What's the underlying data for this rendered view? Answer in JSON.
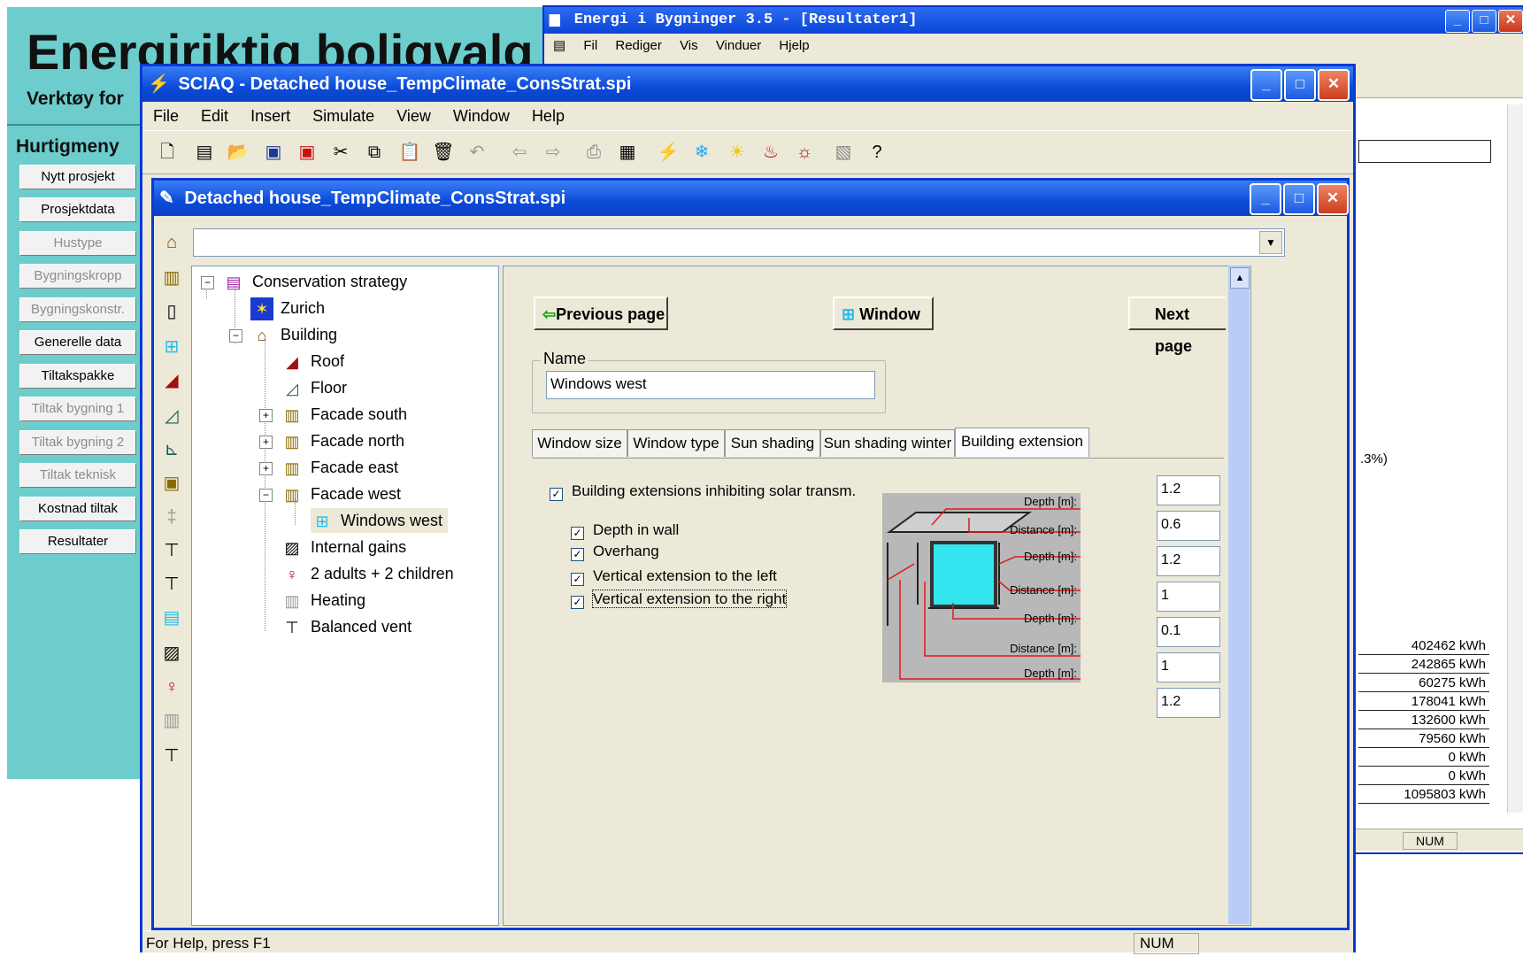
{
  "background_app": {
    "title": "Energiriktig boligvalg",
    "subtitle": "Verktøy for",
    "quickmenu_title": "Hurtigmeny",
    "buttons": [
      {
        "label": "Nytt prosjekt",
        "enabled": true
      },
      {
        "label": "Prosjektdata",
        "enabled": true
      },
      {
        "label": "Hustype",
        "enabled": false
      },
      {
        "label": "Bygningskropp",
        "enabled": false
      },
      {
        "label": "Bygningskonstr.",
        "enabled": false
      },
      {
        "label": "Generelle data",
        "enabled": true
      },
      {
        "label": "Tiltakspakke",
        "enabled": true
      },
      {
        "label": "Tiltak bygning 1",
        "enabled": false
      },
      {
        "label": "Tiltak bygning 2",
        "enabled": false
      },
      {
        "label": "Tiltak teknisk",
        "enabled": false
      },
      {
        "label": "Kostnad tiltak",
        "enabled": true
      },
      {
        "label": "Resultater",
        "enabled": true
      }
    ]
  },
  "energi_window": {
    "title": "Energi i Bygninger 3.5 - [Resultater1]",
    "menu": [
      "Fil",
      "Rediger",
      "Vis",
      "Vinduer",
      "Hjelp"
    ],
    "percent_fragment": ".3%)",
    "results": [
      "402462 kWh",
      "242865 kWh",
      "60275 kWh",
      "178041 kWh",
      "132600 kWh",
      "79560 kWh",
      "0 kWh",
      "0 kWh",
      "1095803 kWh"
    ],
    "status_num": "NUM"
  },
  "sciaq": {
    "title": "SCIAQ - Detached house_TempClimate_ConsStrat.spi",
    "menu": [
      "File",
      "Edit",
      "Insert",
      "Simulate",
      "View",
      "Window",
      "Help"
    ],
    "status_help": "For Help, press F1",
    "status_num": "NUM"
  },
  "doc": {
    "title": "Detached house_TempClimate_ConsStrat.spi",
    "combo_value": "",
    "tree": {
      "root": "Conservation strategy",
      "climate": "Zurich",
      "building": "Building",
      "roof": "Roof",
      "floor": "Floor",
      "facade_south": "Facade south",
      "facade_north": "Facade north",
      "facade_east": "Facade east",
      "facade_west": "Facade west",
      "windows_west": "Windows west",
      "internal_gains": "Internal gains",
      "occupants": "2 adults + 2 children",
      "heating": "Heating",
      "ventilation": "Balanced vent"
    },
    "panel": {
      "prev_button": "Previous page",
      "object_button": "Window",
      "next_button": "Next page",
      "name_label": "Name",
      "name_value": "Windows west",
      "tabs": [
        "Window size",
        "Window type",
        "Sun shading",
        "Sun shading winter",
        "Building extension"
      ],
      "active_tab": "Building extension",
      "main_checkbox": "Building extensions inhibiting solar transm.",
      "checkboxes": [
        "Depth in wall",
        "Overhang",
        "Vertical extension to the left",
        "Vertical extension to the right"
      ],
      "diagram_labels": [
        "Depth [m]:",
        "Distance [m]:",
        "Depth [m]:",
        "Distance [m]:",
        "Depth [m]:",
        "Distance [m]:",
        "Depth [m]:"
      ],
      "values": [
        "1.2",
        "0.6",
        "1.2",
        "1",
        "0.1",
        "1",
        "1.2"
      ]
    }
  },
  "colors": {
    "teal_bg": "#6dcdcc",
    "xp_blue": "#0a45d8",
    "xp_face": "#ece9d8",
    "window_cyan": "#33e5ee",
    "red_line": "#e01818"
  }
}
